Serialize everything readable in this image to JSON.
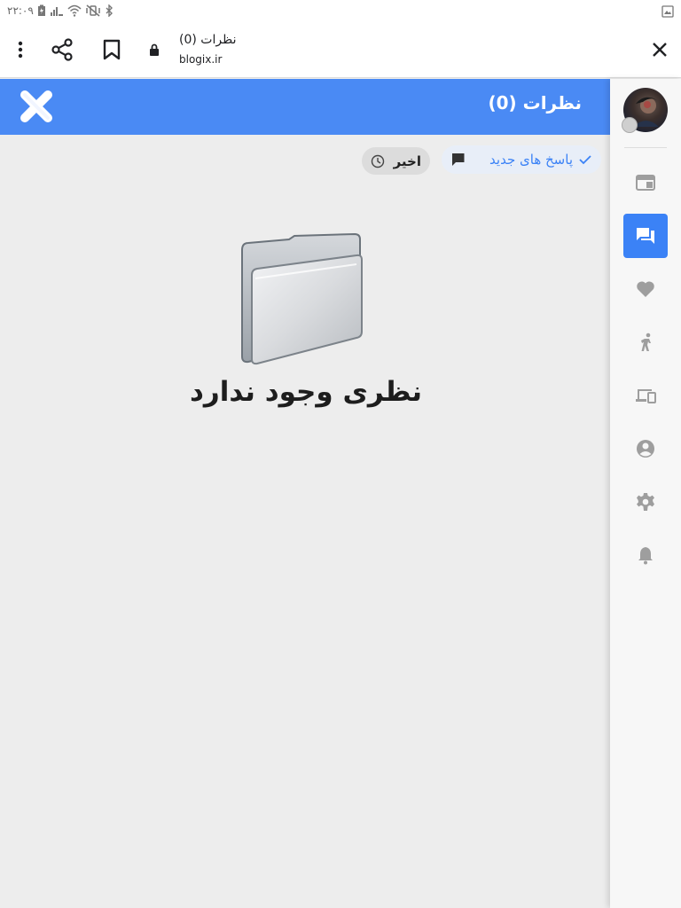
{
  "status_bar": {
    "time": "۲۲:۰۹"
  },
  "browser": {
    "page_title": "نظرات (0)",
    "url": "blogix.ir",
    "icons": [
      "close-icon",
      "lock-icon",
      "bookmark-icon",
      "share-icon",
      "more-vert-icon"
    ]
  },
  "panel": {
    "title": "نظرات (0)",
    "accent_color": "#4a8af4"
  },
  "filters": {
    "new_replies_label": "پاسخ های جدید",
    "recent_label": "اخیر"
  },
  "empty_state": {
    "message": "نظری وجود ندارد"
  },
  "sidebar": {
    "active_color": "#3b82f6",
    "items": [
      {
        "icon": "web-icon"
      },
      {
        "icon": "forum-icon",
        "active": true
      },
      {
        "icon": "heart-icon"
      },
      {
        "icon": "person-run-icon"
      },
      {
        "icon": "devices-icon"
      },
      {
        "icon": "account-circle-icon"
      },
      {
        "icon": "settings-icon"
      },
      {
        "icon": "notifications-icon"
      }
    ]
  }
}
